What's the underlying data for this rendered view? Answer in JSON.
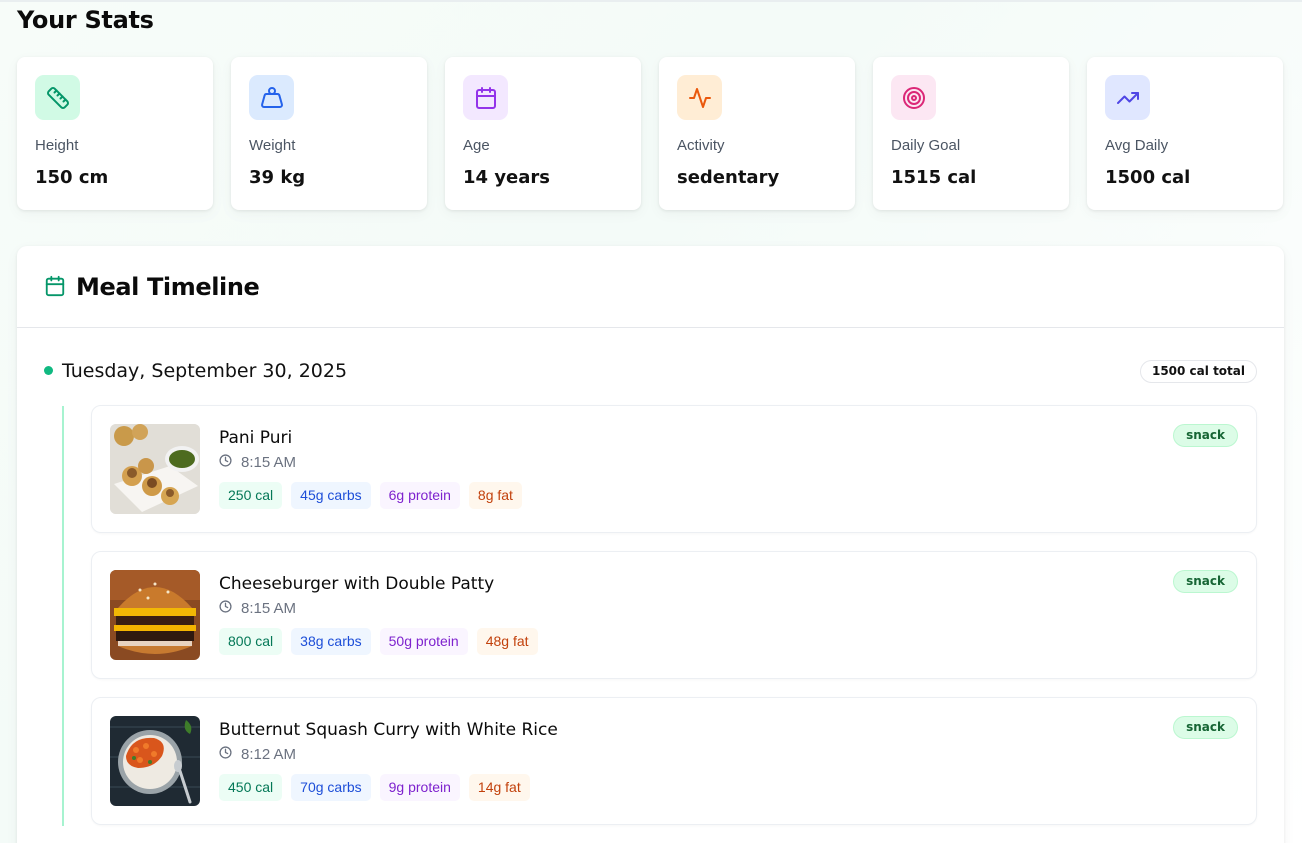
{
  "page": {
    "title": "Your Stats"
  },
  "stats": [
    {
      "label": "Height",
      "value": "150 cm",
      "icon": "ruler-icon",
      "bg": "#d1fae5",
      "color": "#059669"
    },
    {
      "label": "Weight",
      "value": "39 kg",
      "icon": "weight-icon",
      "bg": "#dbeafe",
      "color": "#2563eb"
    },
    {
      "label": "Age",
      "value": "14 years",
      "icon": "calendar-icon",
      "bg": "#f3e8ff",
      "color": "#9333ea"
    },
    {
      "label": "Activity",
      "value": "sedentary",
      "icon": "activity-icon",
      "bg": "#ffedd5",
      "color": "#ea580c"
    },
    {
      "label": "Daily Goal",
      "value": "1515 cal",
      "icon": "target-icon",
      "bg": "#fce7f3",
      "color": "#db2777"
    },
    {
      "label": "Avg Daily",
      "value": "1500 cal",
      "icon": "trending-up-icon",
      "bg": "#e0e7ff",
      "color": "#4f46e5"
    }
  ],
  "timeline": {
    "title": "Meal Timeline",
    "accent": "#059669",
    "day": {
      "date": "Tuesday, September 30, 2025",
      "total": "1500 cal total"
    },
    "meals": [
      {
        "name": "Pani Puri",
        "time": "8:15 AM",
        "calories": "250 cal",
        "carbs": "45g carbs",
        "protein": "6g protein",
        "fat": "8g fat",
        "type": "snack"
      },
      {
        "name": "Cheeseburger with Double Patty",
        "time": "8:15 AM",
        "calories": "800 cal",
        "carbs": "38g carbs",
        "protein": "50g protein",
        "fat": "48g fat",
        "type": "snack"
      },
      {
        "name": "Butternut Squash Curry with White Rice",
        "time": "8:12 AM",
        "calories": "450 cal",
        "carbs": "70g carbs",
        "protein": "9g protein",
        "fat": "14g fat",
        "type": "snack"
      }
    ]
  }
}
